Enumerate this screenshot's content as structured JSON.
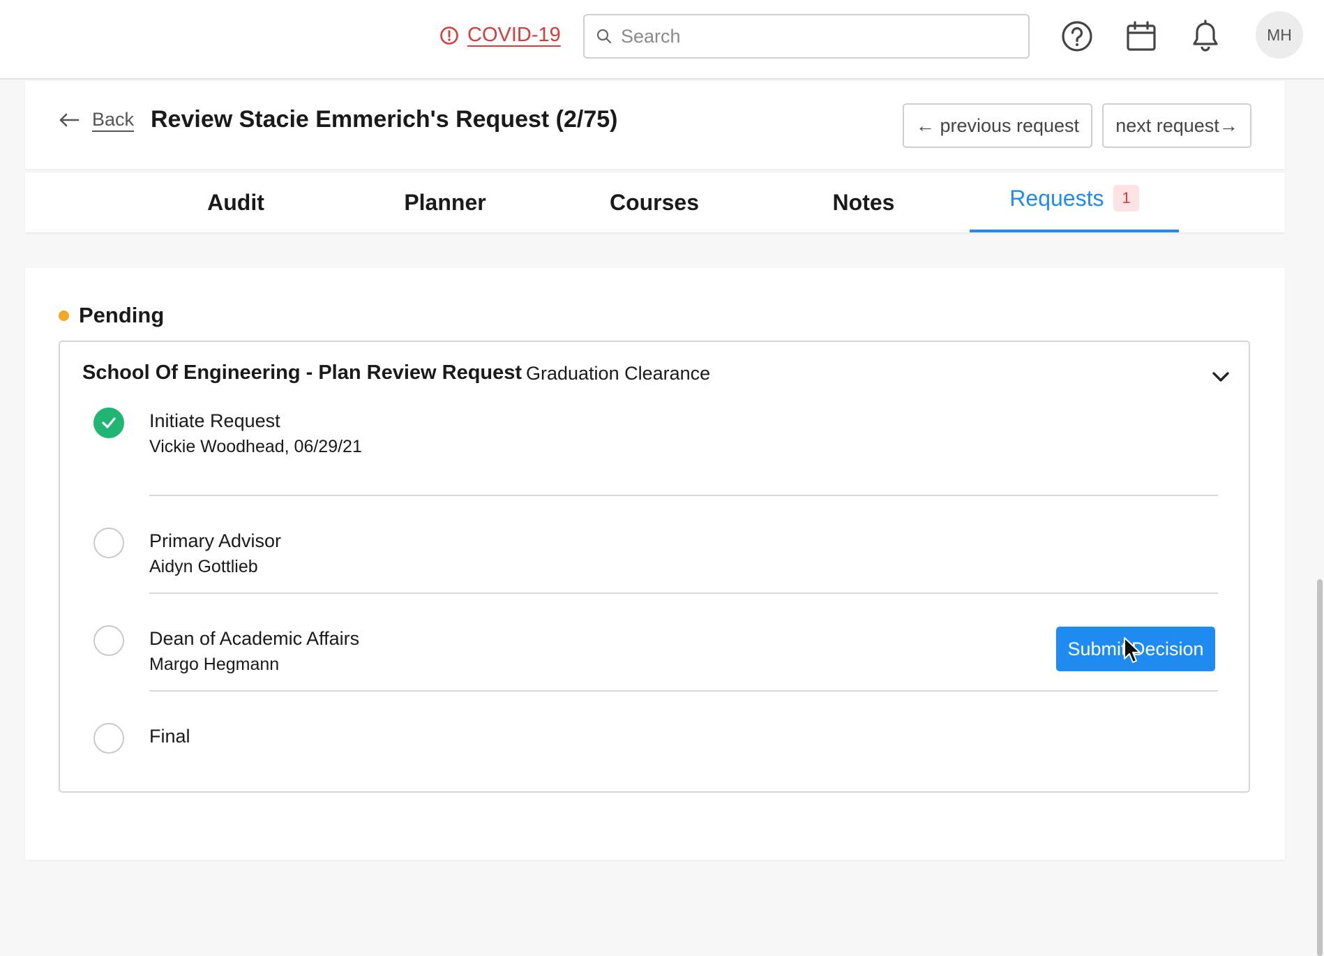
{
  "topbar": {
    "alert_label": "COVID-19",
    "search_placeholder": "Search",
    "avatar_initials": "MH"
  },
  "header": {
    "back_label": "Back",
    "title": "Review Stacie Emmerich's Request (2/75)",
    "previous_label": "← previous request",
    "next_label": "next request→"
  },
  "tabs": [
    {
      "label": "Audit"
    },
    {
      "label": "Planner"
    },
    {
      "label": "Courses"
    },
    {
      "label": "Notes"
    },
    {
      "label": "Requests",
      "count": "1",
      "active": true
    }
  ],
  "request": {
    "status": "Pending",
    "status_color": "#f5a623",
    "title": "School Of Engineering - Plan Review Request",
    "type": "Graduation Clearance",
    "steps": [
      {
        "name": "Initiate Request",
        "who": "Vickie Woodhead, 06/29/21",
        "done": true
      },
      {
        "name": "Primary Advisor",
        "who": "Aidyn Gottlieb",
        "done": false
      },
      {
        "name": "Dean of Academic Affairs",
        "who": "Margo Hegmann",
        "done": false
      },
      {
        "name": "Final",
        "who": "",
        "done": false
      }
    ],
    "submit_label": "Submit Decision"
  },
  "colors": {
    "accent": "#1f8bf0",
    "alert": "#d93a3a",
    "done": "#21b573"
  }
}
